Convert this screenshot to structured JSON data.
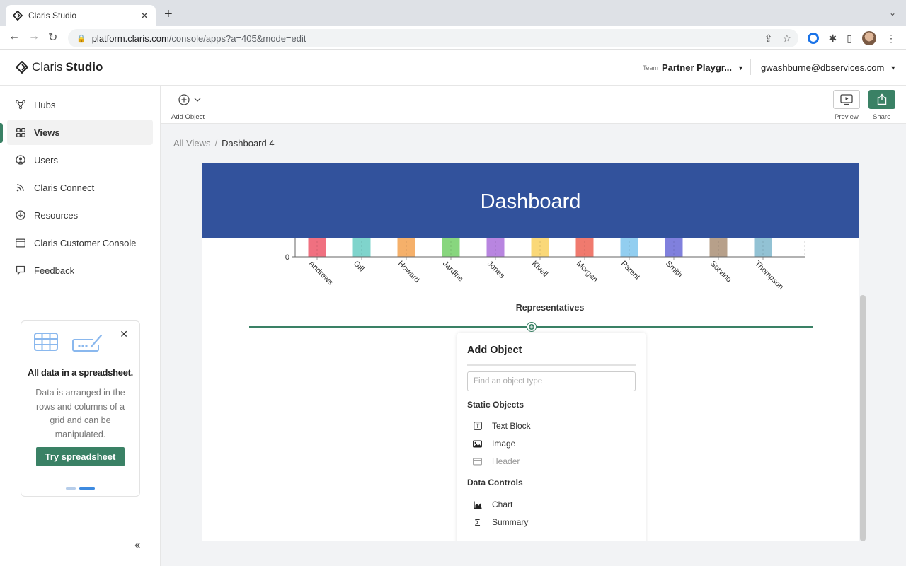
{
  "browser": {
    "tab_title": "Claris Studio",
    "url_host": "platform.claris.com",
    "url_path": "/console/apps?a=405&mode=edit"
  },
  "app": {
    "logo_light": "Claris",
    "logo_bold": "Studio",
    "team_label": "Team",
    "team_name": "Partner Playgr...",
    "user_email": "gwashburne@dbservices.com"
  },
  "sidebar": {
    "items": [
      {
        "label": "Hubs",
        "icon": "hubs-icon"
      },
      {
        "label": "Views",
        "icon": "grid-icon",
        "active": true
      },
      {
        "label": "Users",
        "icon": "user-circle-icon"
      },
      {
        "label": "Claris Connect",
        "icon": "rss-icon"
      },
      {
        "label": "Resources",
        "icon": "download-circle-icon"
      },
      {
        "label": "Claris Customer Console",
        "icon": "window-icon"
      },
      {
        "label": "Feedback",
        "icon": "speech-bubble-icon"
      }
    ],
    "promo": {
      "title": "All data in a spreadsheet.",
      "body": "Data is arranged in the rows and columns of a grid and can be manipulated.",
      "button": "Try spreadsheet",
      "page": 2,
      "pages": 2
    }
  },
  "toolbar": {
    "add_object": "Add Object",
    "preview": "Preview",
    "share": "Share"
  },
  "breadcrumb": {
    "parent": "All Views",
    "separator": "/",
    "current": "Dashboard 4"
  },
  "dashboard": {
    "header_title": "Dashboard",
    "accent": "#32529c",
    "divider_color": "#3a8165"
  },
  "chart_data": {
    "type": "bar",
    "title": "",
    "xlabel": "Representatives",
    "ylabel": "",
    "categories": [
      "Andrews",
      "Gill",
      "Howard",
      "Jardine",
      "Jones",
      "Kivell",
      "Morgan",
      "Parent",
      "Smith",
      "Sorvino",
      "Thompson"
    ],
    "colors": [
      "#f07080",
      "#7fd4cc",
      "#f5b06a",
      "#88d67e",
      "#b885e0",
      "#fad878",
      "#f07a6e",
      "#92cef0",
      "#8080dd",
      "#b7a08a",
      "#92c2d4"
    ],
    "y_ticks_visible": [
      0
    ],
    "note": "Bar tops are hidden behind the dashboard header; only the baseline 0 is visible"
  },
  "add_object_popover": {
    "title": "Add Object",
    "search_placeholder": "Find an object type",
    "sections": [
      {
        "title": "Static Objects",
        "items": [
          {
            "label": "Text Block",
            "icon": "text-block-icon",
            "enabled": true
          },
          {
            "label": "Image",
            "icon": "image-icon",
            "enabled": true
          },
          {
            "label": "Header",
            "icon": "header-icon",
            "enabled": false
          }
        ]
      },
      {
        "title": "Data Controls",
        "items": [
          {
            "label": "Chart",
            "icon": "chart-icon",
            "enabled": true
          },
          {
            "label": "Summary",
            "icon": "sigma-icon",
            "enabled": true
          }
        ]
      }
    ]
  }
}
